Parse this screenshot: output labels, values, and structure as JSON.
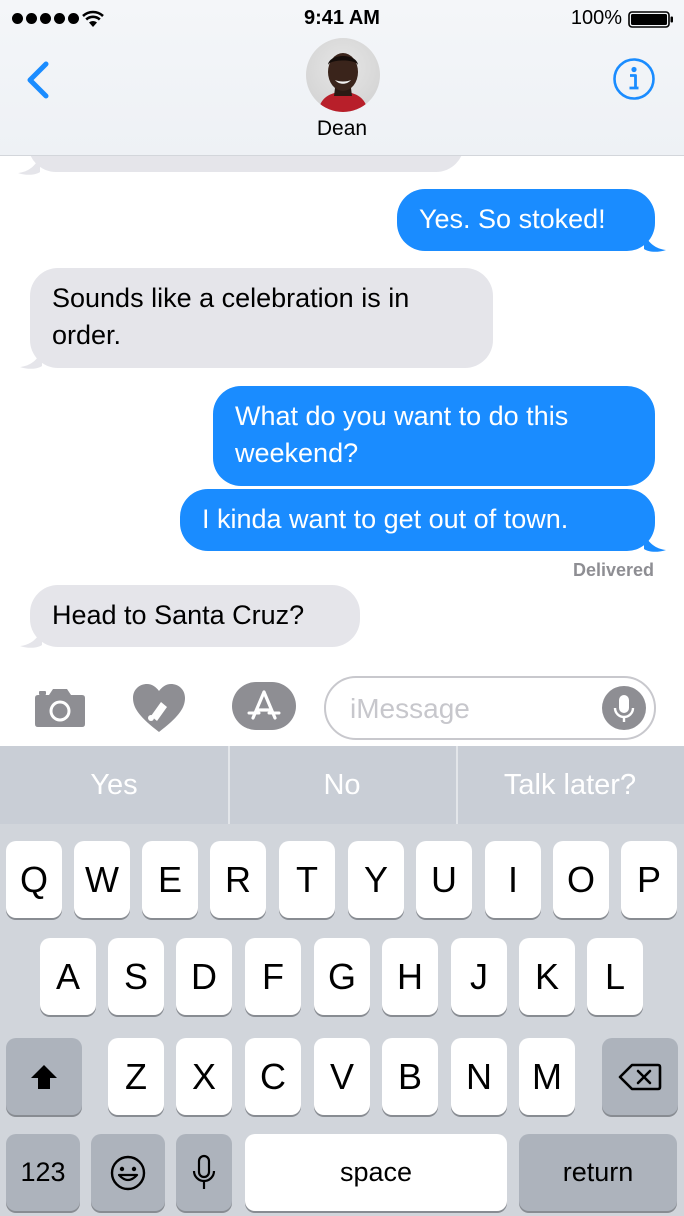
{
  "status_bar": {
    "time": "9:41 AM",
    "battery": "100%"
  },
  "header": {
    "contact_name": "Dean"
  },
  "conversation": {
    "messages": [
      {
        "side": "outgoing",
        "text": "Yes. So stoked!"
      },
      {
        "side": "incoming",
        "text": "Sounds like a celebration is in order."
      },
      {
        "side": "outgoing",
        "text": "What do you want to do this weekend?"
      },
      {
        "side": "outgoing",
        "text": "I kinda want to get out of town."
      },
      {
        "side": "incoming",
        "text": "Head to Santa Cruz?"
      }
    ],
    "delivered": "Delivered"
  },
  "input_bar": {
    "placeholder": "iMessage"
  },
  "predictive": {
    "suggestions": [
      "Yes",
      "No",
      "Talk later?"
    ]
  },
  "keyboard": {
    "row1": [
      "Q",
      "W",
      "E",
      "R",
      "T",
      "Y",
      "U",
      "I",
      "O",
      "P"
    ],
    "row2": [
      "A",
      "S",
      "D",
      "F",
      "G",
      "H",
      "J",
      "K",
      "L"
    ],
    "row3": [
      "Z",
      "X",
      "C",
      "V",
      "B",
      "N",
      "M"
    ],
    "numbers_label": "123",
    "space_label": "space",
    "return_label": "return"
  },
  "colors": {
    "accent": "#1a8cff",
    "incoming_bubble": "#e5e5ea",
    "keyboard_bg": "#d1d5db",
    "dark_key": "#adb3bc",
    "predictive_bg": "#c9ced6"
  },
  "icons": [
    "wifi-icon",
    "battery-icon",
    "back-chevron-icon",
    "info-icon",
    "camera-icon",
    "digital-touch-icon",
    "app-store-icon",
    "microphone-icon",
    "shift-icon",
    "delete-icon",
    "emoji-icon"
  ]
}
